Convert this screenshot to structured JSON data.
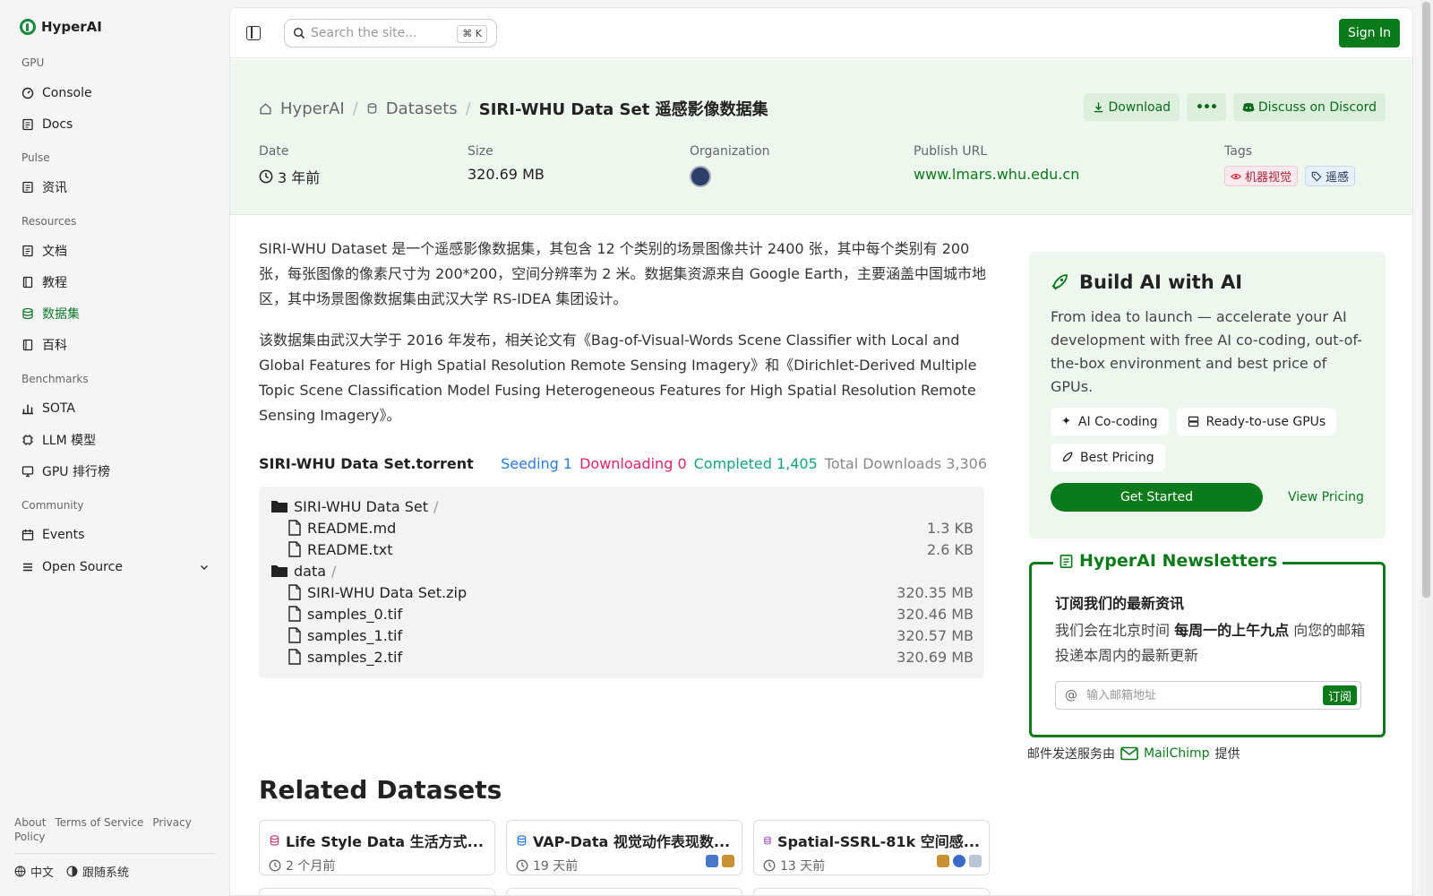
{
  "brand": {
    "name": "HyperAI"
  },
  "sidebar": {
    "groups": [
      {
        "title": "GPU",
        "items": [
          {
            "label": "Console"
          },
          {
            "label": "Docs"
          }
        ]
      },
      {
        "title": "Pulse",
        "items": [
          {
            "label": "资讯"
          }
        ]
      },
      {
        "title": "Resources",
        "items": [
          {
            "label": "文档"
          },
          {
            "label": "教程"
          },
          {
            "label": "数据集",
            "active": true
          },
          {
            "label": "百科"
          }
        ]
      },
      {
        "title": "Benchmarks",
        "items": [
          {
            "label": "SOTA"
          },
          {
            "label": "LLM 模型"
          },
          {
            "label": "GPU 排行榜"
          }
        ]
      },
      {
        "title": "Community",
        "items": [
          {
            "label": "Events"
          },
          {
            "label": "Open Source"
          }
        ]
      }
    ],
    "footer_links": [
      "About",
      "Terms of Service",
      "Privacy Policy"
    ],
    "language": "中文",
    "theme": "跟随系统"
  },
  "topbar": {
    "search_placeholder": "Search the site...",
    "shortcut": "⌘ K",
    "signin": "Sign In"
  },
  "header": {
    "breadcrumb": [
      "HyperAI",
      "Datasets",
      "SIRI-WHU Data Set 遥感影像数据集"
    ],
    "actions": {
      "download": "Download",
      "more": "•••",
      "discord": "Discuss on Discord"
    },
    "meta": {
      "date_label": "Date",
      "date": "3 年前",
      "size_label": "Size",
      "size": "320.69 MB",
      "org_label": "Organization",
      "url_label": "Publish URL",
      "url": "www.lmars.whu.edu.cn",
      "tags_label": "Tags",
      "tags": [
        "机器视觉",
        "遥感"
      ]
    }
  },
  "description": {
    "p1": "SIRI-WHU Dataset 是一个遥感影像数据集，其包含 12 个类别的场景图像共计 2400 张，其中每个类别有 200 张，每张图像的像素尺寸为 200*200，空间分辨率为 2 米。数据集资源来自 Google Earth，主要涵盖中国城市地区，其中场景图像数据集由武汉大学 RS-IDEA 集团设计。",
    "p2": "该数据集由武汉大学于 2016 年发布，相关论文有《Bag-of-Visual-Words Scene Classifier with Local and Global Features for High Spatial Resolution Remote Sensing Imagery》和《Dirichlet-Derived Multiple Topic Scene Classification Model Fusing Heterogeneous Features for High Spatial Resolution Remote Sensing Imagery》。"
  },
  "torrent": {
    "name": "SIRI-WHU Data Set.torrent",
    "seeding": "Seeding 1",
    "downloading": "Downloading 0",
    "completed": "Completed 1,405",
    "total": "Total Downloads 3,306",
    "files": [
      {
        "name": "SIRI-WHU Data Set",
        "folder": true,
        "size": "",
        "level": 0
      },
      {
        "name": "README.md",
        "folder": false,
        "size": "1.3 KB",
        "level": 1
      },
      {
        "name": "README.txt",
        "folder": false,
        "size": "2.6 KB",
        "level": 1
      },
      {
        "name": "data",
        "folder": true,
        "size": "",
        "level": 0
      },
      {
        "name": "SIRI-WHU Data Set.zip",
        "folder": false,
        "size": "320.35 MB",
        "level": 1
      },
      {
        "name": "samples_0.tif",
        "folder": false,
        "size": "320.46 MB",
        "level": 1
      },
      {
        "name": "samples_1.tif",
        "folder": false,
        "size": "320.57 MB",
        "level": 1
      },
      {
        "name": "samples_2.tif",
        "folder": false,
        "size": "320.69 MB",
        "level": 1
      }
    ]
  },
  "related": {
    "title": "Related Datasets",
    "cards": [
      {
        "title": "Life Style Data 生活方式...",
        "date": "2 个月前"
      },
      {
        "title": "VAP-Data 视觉动作表现数...",
        "date": "19 天前"
      },
      {
        "title": "Spatial-SSRL-81k 空间感...",
        "date": "13 天前"
      }
    ]
  },
  "build_ai": {
    "title": "Build AI with AI",
    "desc": "From idea to launch — accelerate your AI development with free AI co-coding, out-of-the-box environment and best price of GPUs.",
    "chips": [
      "AI Co-coding",
      "Ready-to-use GPUs",
      "Best Pricing"
    ],
    "cta": "Get Started",
    "pricing": "View Pricing"
  },
  "newsletter": {
    "title": "HyperAI Newsletters",
    "heading": "订阅我们的最新资讯",
    "text_pre": "我们会在北京时间 ",
    "text_bold": "每周一的上午九点",
    "text_post": " 向您的邮箱投递本周内的最新更新",
    "placeholder": "输入邮箱地址",
    "subscribe": "订阅",
    "provider_pre": "邮件发送服务由",
    "provider": "MailChimp",
    "provider_post": "提供"
  },
  "colors": {
    "brand": "#0a7a1a",
    "seeding": "#2a7ae2",
    "downloading": "#e0245e",
    "completed": "#14a37f"
  }
}
